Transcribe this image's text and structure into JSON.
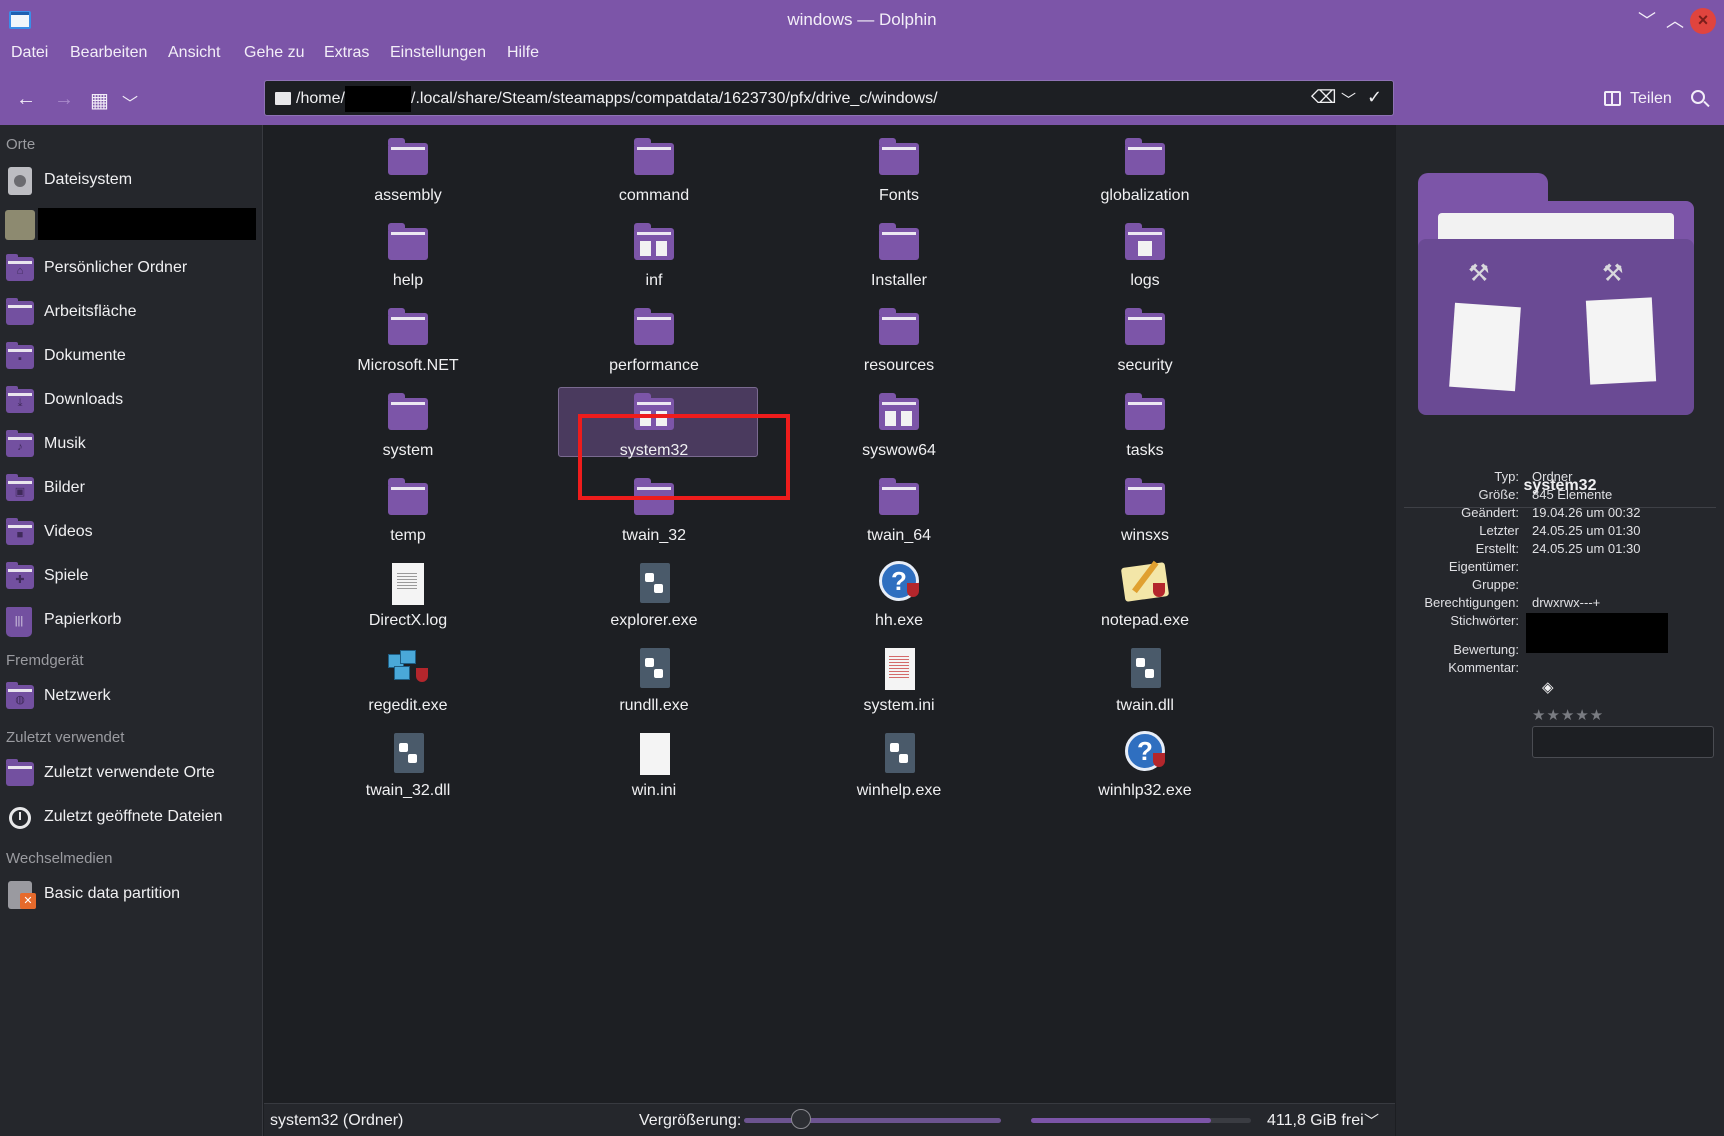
{
  "window": {
    "title": "windows — Dolphin",
    "minimize_glyph": "﹀",
    "maximize_glyph": "︿",
    "close_glyph": "×"
  },
  "menu": [
    "Datei",
    "Bearbeiten",
    "Ansicht",
    "Gehe zu",
    "Extras",
    "Einstellungen",
    "Hilfe"
  ],
  "toolbar": {
    "back_glyph": "←",
    "forward_glyph": "→",
    "view_glyph": "▦",
    "view_menu_glyph": "﹀",
    "path_prefix": "/home/",
    "path_suffix": "/.local/share/Steam/steamapps/compatdata/1623730/pfx/drive_c/windows/",
    "clear_glyph": "⌫",
    "dropdown_glyph": "﹀",
    "confirm_glyph": "✓",
    "share_label": "Teilen"
  },
  "sidebar": {
    "sections": {
      "places": "Orte",
      "remote": "Fremdgerät",
      "recent": "Zuletzt verwendet",
      "removable": "Wechselmedien"
    },
    "items": [
      {
        "label": "Dateisystem",
        "icon": "drive-icon"
      },
      {
        "label": "",
        "icon": "server-icon"
      },
      {
        "label": "Persönlicher Ordner",
        "icon": "home-folder-icon",
        "glyph": "⌂"
      },
      {
        "label": "Arbeitsfläche",
        "icon": "desktop-folder-icon",
        "glyph": ""
      },
      {
        "label": "Dokumente",
        "icon": "documents-folder-icon",
        "glyph": "▪"
      },
      {
        "label": "Downloads",
        "icon": "downloads-folder-icon",
        "glyph": "⤓"
      },
      {
        "label": "Musik",
        "icon": "music-folder-icon",
        "glyph": "♪"
      },
      {
        "label": "Bilder",
        "icon": "pictures-folder-icon",
        "glyph": "▣"
      },
      {
        "label": "Videos",
        "icon": "videos-folder-icon",
        "glyph": "■"
      },
      {
        "label": "Spiele",
        "icon": "games-folder-icon",
        "glyph": "✚"
      },
      {
        "label": "Papierkorb",
        "icon": "trash-icon",
        "glyph": "|||"
      },
      {
        "label": "Netzwerk",
        "icon": "network-folder-icon",
        "glyph": "◍"
      },
      {
        "label": "Zuletzt verwendete Orte",
        "icon": "recent-places-icon",
        "glyph": ""
      },
      {
        "label": "Zuletzt geöffnete Dateien",
        "icon": "clock-icon"
      },
      {
        "label": "Basic data partition",
        "icon": "usb-drive-icon"
      }
    ]
  },
  "files": [
    {
      "name": "assembly",
      "kind": "folder"
    },
    {
      "name": "command",
      "kind": "folder"
    },
    {
      "name": "Fonts",
      "kind": "folder"
    },
    {
      "name": "globalization",
      "kind": "folder"
    },
    {
      "name": "help",
      "kind": "folder"
    },
    {
      "name": "inf",
      "kind": "folder-docs"
    },
    {
      "name": "Installer",
      "kind": "folder"
    },
    {
      "name": "logs",
      "kind": "folder-doc"
    },
    {
      "name": "Microsoft.NET",
      "kind": "folder"
    },
    {
      "name": "performance",
      "kind": "folder"
    },
    {
      "name": "resources",
      "kind": "folder"
    },
    {
      "name": "security",
      "kind": "folder"
    },
    {
      "name": "system",
      "kind": "folder"
    },
    {
      "name": "system32",
      "kind": "folder-docs",
      "selected": true
    },
    {
      "name": "syswow64",
      "kind": "folder-docs"
    },
    {
      "name": "tasks",
      "kind": "folder"
    },
    {
      "name": "temp",
      "kind": "folder"
    },
    {
      "name": "twain_32",
      "kind": "folder"
    },
    {
      "name": "twain_64",
      "kind": "folder"
    },
    {
      "name": "winsxs",
      "kind": "folder"
    },
    {
      "name": "DirectX.log",
      "kind": "text-file"
    },
    {
      "name": "explorer.exe",
      "kind": "executable"
    },
    {
      "name": "hh.exe",
      "kind": "help-executable"
    },
    {
      "name": "notepad.exe",
      "kind": "notepad-executable"
    },
    {
      "name": "regedit.exe",
      "kind": "regedit-executable"
    },
    {
      "name": "rundll.exe",
      "kind": "executable"
    },
    {
      "name": "system.ini",
      "kind": "ini-file"
    },
    {
      "name": "twain.dll",
      "kind": "executable"
    },
    {
      "name": "twain_32.dll",
      "kind": "executable"
    },
    {
      "name": "win.ini",
      "kind": "plain-file"
    },
    {
      "name": "winhelp.exe",
      "kind": "executable"
    },
    {
      "name": "winhlp32.exe",
      "kind": "help-executable"
    }
  ],
  "statusbar": {
    "selection": "system32 (Ordner)",
    "zoom_label": "Vergrößerung:",
    "free_space": "411,8 GiB frei",
    "used_space_fraction": 0.82,
    "chevron_glyph": "﹀"
  },
  "info": {
    "name": "system32",
    "rows": [
      {
        "key": "Typ:",
        "value": "Ordner"
      },
      {
        "key": "Größe:",
        "value": "845 Elemente"
      },
      {
        "key": "Geändert:",
        "value": "19.04.26 um 00:32"
      },
      {
        "key": "Letzter",
        "value": "24.05.25 um 01:30"
      },
      {
        "key": "Erstellt:",
        "value": "24.05.25 um 01:30"
      },
      {
        "key": "Eigentümer:",
        "value": ""
      },
      {
        "key": "Gruppe:",
        "value": ""
      },
      {
        "key": "Berechtigungen:",
        "value": "drwxrwx---+"
      },
      {
        "key": "Stichwörter:",
        "value": ""
      },
      {
        "key": "Bewertung:",
        "value": ""
      },
      {
        "key": "Kommentar:",
        "value": ""
      }
    ],
    "rating": 0,
    "rating_max": 5,
    "stars_glyph": "★★★★★",
    "tag_glyph": "◈"
  },
  "colors": {
    "chrome": "#7c55a8",
    "folder": "#7c55a8",
    "selection_highlight": "#ee1c1c",
    "close_button": "#e0443e"
  }
}
